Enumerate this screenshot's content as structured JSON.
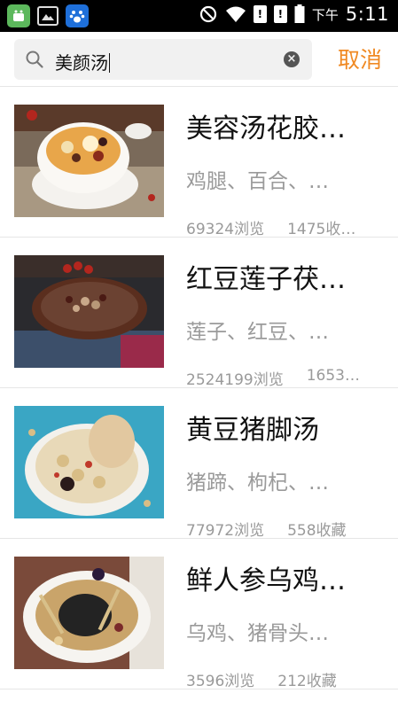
{
  "status_bar": {
    "ampm": "下午",
    "time": "5:11",
    "sim1": "!",
    "sim2": "!",
    "icons": [
      "app-store-icon",
      "image-icon",
      "paw-app-icon",
      "mute-icon",
      "wifi-icon",
      "sim-icon",
      "sim-icon",
      "battery-icon"
    ]
  },
  "search": {
    "value": "美颜汤",
    "cancel_label": "取消"
  },
  "results": [
    {
      "title": "美容汤花胶…",
      "ingredients": "鸡腿、百合、…",
      "views": "69324浏览",
      "favorites": "1475收…",
      "image": "soup-bowl-photo"
    },
    {
      "title": "红豆莲子茯…",
      "ingredients": "莲子、红豆、…",
      "views": "2524199浏览",
      "favorites": "1653…",
      "image": "red-bean-soup-photo"
    },
    {
      "title": "黄豆猪脚汤",
      "ingredients": "猪蹄、枸杞、…",
      "views": "77972浏览",
      "favorites": "558收藏",
      "image": "pork-trotter-soup-photo"
    },
    {
      "title": "鲜人参乌鸡…",
      "ingredients": "乌鸡、猪骨头…",
      "views": "3596浏览",
      "favorites": "212收藏",
      "image": "black-chicken-soup-photo"
    }
  ],
  "colors": {
    "accent": "#f08a24",
    "muted_text": "#9a9a9a",
    "status_bar": "#000000"
  }
}
